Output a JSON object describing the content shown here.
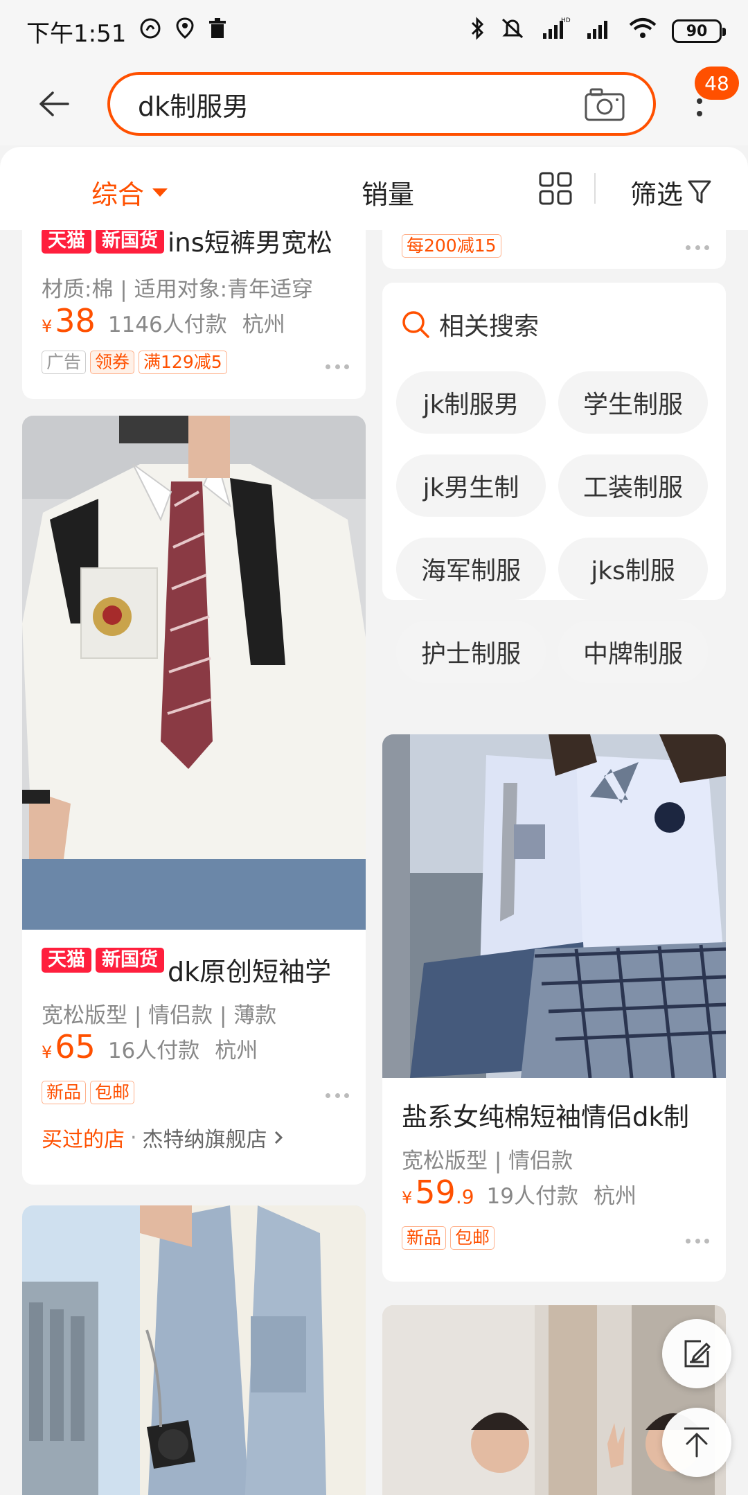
{
  "status_bar": {
    "time": "下午1:51",
    "battery": "90"
  },
  "header": {
    "search_query": "dk制服男",
    "cart_badge": "48"
  },
  "sort_bar": {
    "comprehensive": "综合",
    "sales": "销量",
    "filter": "筛选"
  },
  "left_column": {
    "card1": {
      "title_partial": "ins短裤男宽松",
      "attrs": "材质:棉 | 适用对象:青年适穿",
      "price": "38",
      "sales": "1146人付款",
      "city": "杭州",
      "tags": [
        "广告",
        "领券",
        "满129减5"
      ]
    },
    "card2": {
      "badge_tmall": "天猫",
      "badge_new": "新国货",
      "title": "dk原创短袖学",
      "attrs": "宽松版型 | 情侣款 | 薄款",
      "price": "65",
      "sales": "16人付款",
      "city": "杭州",
      "tags": [
        "新品",
        "包邮"
      ],
      "shop_prefix": "买过的店",
      "shop_name": "杰特纳旗舰店"
    }
  },
  "right_column": {
    "card1": {
      "tag": "每200减15"
    },
    "related": {
      "heading": "相关搜索",
      "chips": [
        "jk制服男",
        "学生制服",
        "jk男生制",
        "工装制服",
        "海军制服",
        "jks制服",
        "护士制服",
        "中牌制服"
      ]
    },
    "card2": {
      "title": "盐系女纯棉短袖情侣dk制",
      "attrs": "宽松版型 | 情侣款",
      "price_int": "59",
      "price_dec": ".9",
      "sales": "19人付款",
      "city": "杭州",
      "tags": [
        "新品",
        "包邮"
      ]
    }
  }
}
